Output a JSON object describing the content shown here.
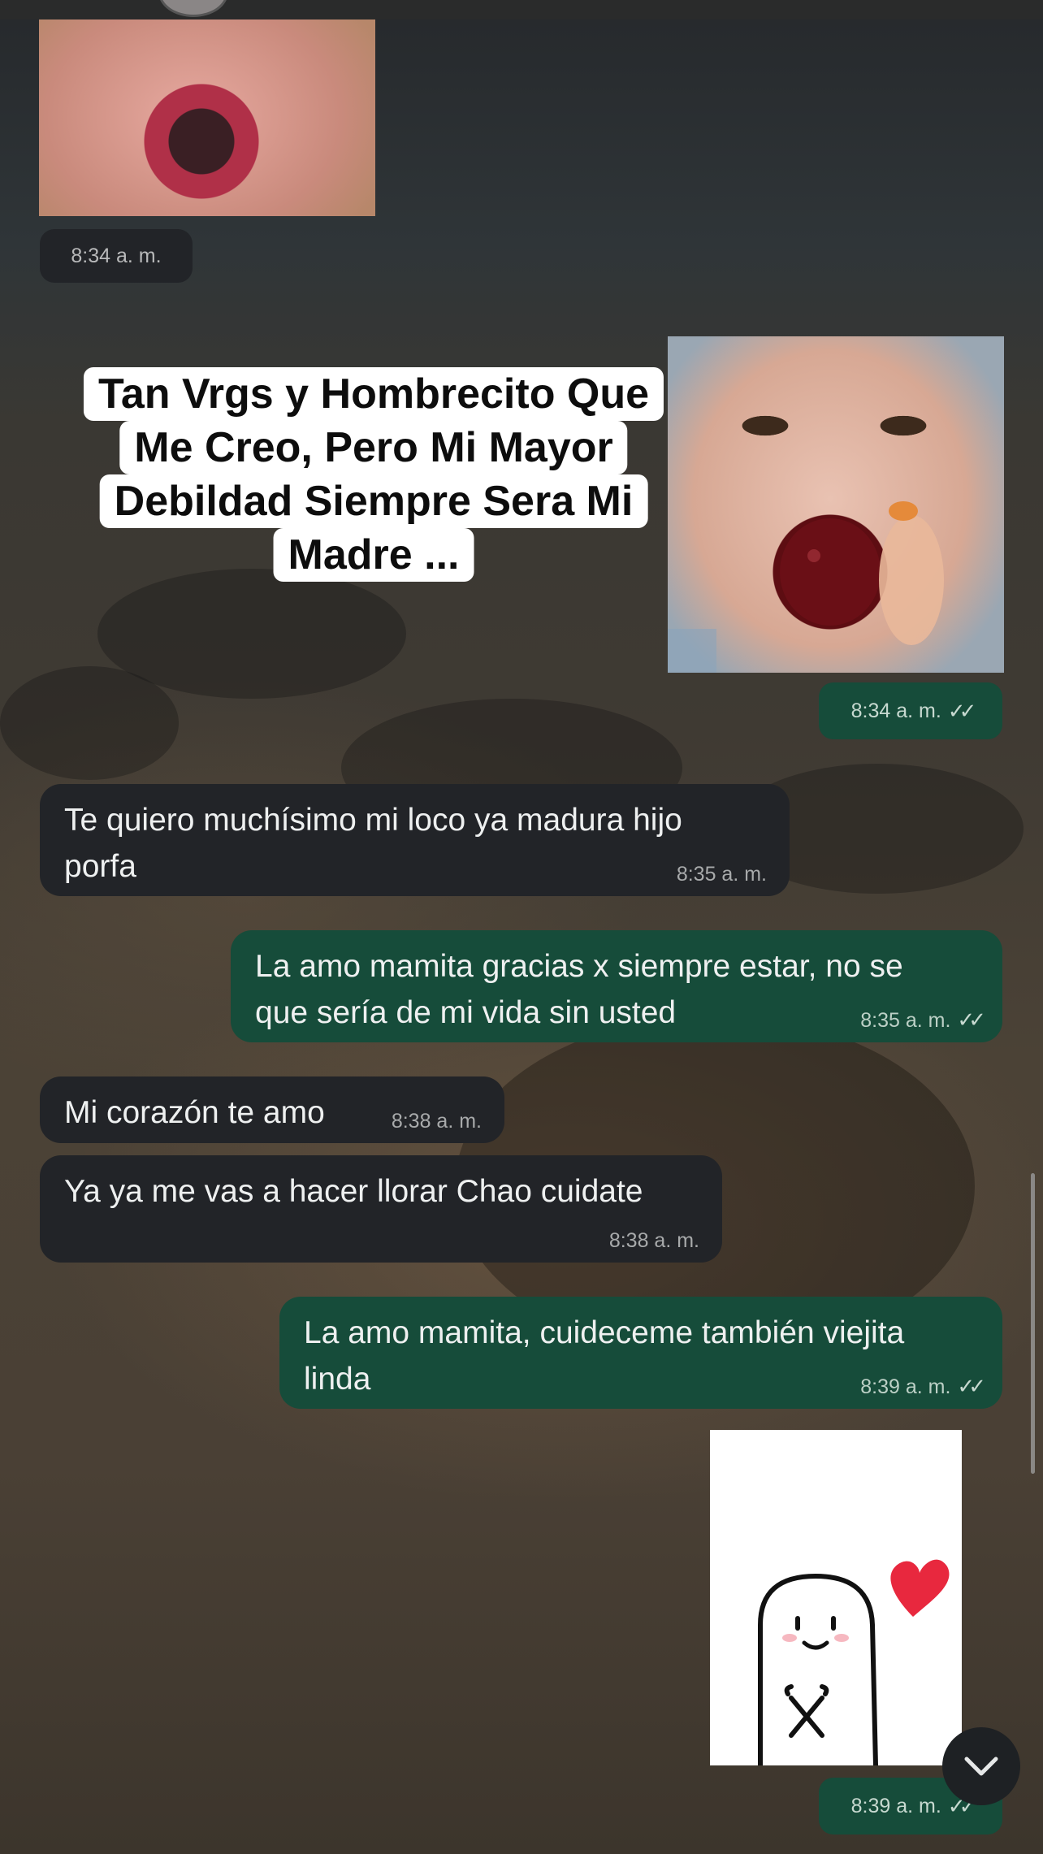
{
  "messages": {
    "m1": {
      "time": "8:34 a. m."
    },
    "m2": {
      "caption_lines": [
        "Tan Vrgs y Hombrecito Que",
        "Me Creo, Pero Mi Mayor",
        "Debildad Siempre Sera Mi",
        "Madre ..."
      ],
      "time": "8:34 a. m."
    },
    "m3": {
      "line1": "Te quiero muchísimo mi  loco ya madura hijo",
      "line2": "porfa",
      "time": "8:35 a. m."
    },
    "m4": {
      "line1": "La amo mamita gracias x siempre estar, no se",
      "line2": "que sería de mi vida sin usted",
      "time": "8:35 a. m."
    },
    "m5": {
      "text": "Mi corazón te amo",
      "time": "8:38 a. m."
    },
    "m6": {
      "text": "Ya ya me vas a hacer llorar Chao cuidate",
      "time": "8:38 a. m."
    },
    "m7": {
      "line1": "La amo mamita, cuideceme también viejita",
      "line2": "linda",
      "time": "8:39 a. m."
    },
    "m8": {
      "time": "8:39 a. m."
    }
  },
  "icons": {
    "read_receipt": "double-check-icon",
    "scroll_down": "chevron-down-icon"
  },
  "colors": {
    "incoming_bubble": "#222428",
    "outgoing_bubble": "#164c3a",
    "heart": "#e8283e"
  }
}
